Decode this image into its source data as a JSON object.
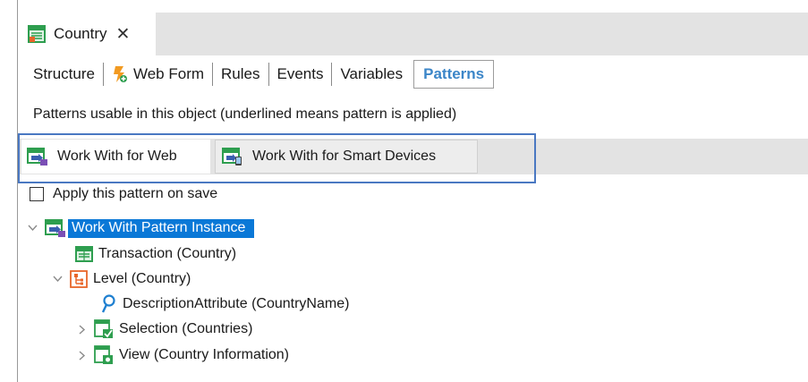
{
  "doc_tab": {
    "title": "Country",
    "close": "✕",
    "icon": "transaction-icon"
  },
  "toolbar": {
    "items": [
      {
        "label": "Structure"
      },
      {
        "label": "Web Form",
        "icon": "web-form-icon"
      },
      {
        "label": "Rules"
      },
      {
        "label": "Events"
      },
      {
        "label": "Variables"
      },
      {
        "label": "Patterns",
        "active": true
      }
    ]
  },
  "hint": "Patterns usable in this object (underlined means pattern is applied)",
  "pattern_tabs": [
    {
      "label": "Work With for Web",
      "icon": "work-with-web-icon",
      "active": true
    },
    {
      "label": "Work With for Smart Devices",
      "icon": "work-with-smart-devices-icon",
      "active": false
    }
  ],
  "apply_on_save": {
    "label": "Apply this pattern on save",
    "checked": false
  },
  "tree": {
    "root": {
      "label": "Work With Pattern Instance",
      "expanded": true,
      "selected": true
    },
    "transaction": {
      "label": "Transaction (Country)"
    },
    "level": {
      "label": "Level (Country)",
      "expanded": true
    },
    "description_attribute": {
      "label": "DescriptionAttribute (CountryName)"
    },
    "selection": {
      "label": "Selection (Countries)",
      "expanded": false
    },
    "view": {
      "label": "View (Country Information)",
      "expanded": false
    }
  },
  "colors": {
    "accent": "#3c86c8",
    "selection": "#0a78d7",
    "highlight_box": "#4a78c2",
    "icon_green": "#2e9e4f"
  }
}
